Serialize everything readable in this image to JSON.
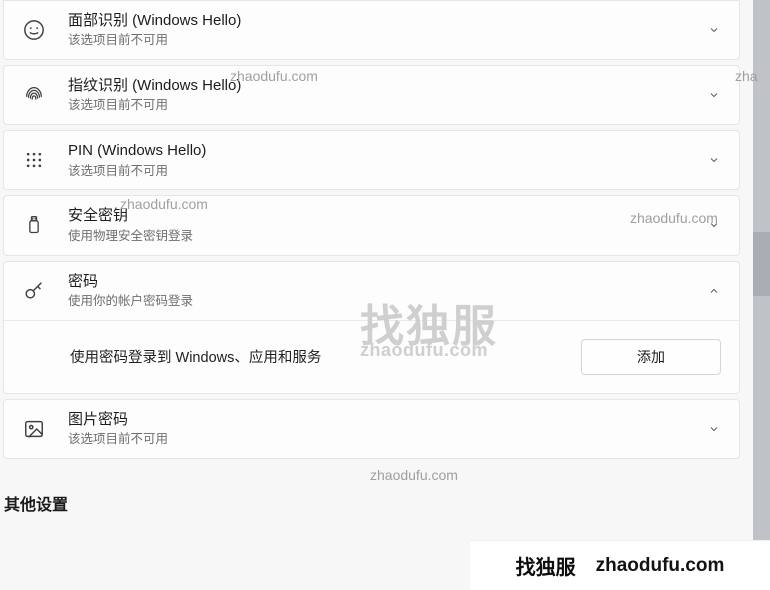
{
  "options": {
    "face": {
      "title": "面部识别 (Windows Hello)",
      "subtitle": "该选项目前不可用"
    },
    "fingerprint": {
      "title": "指纹识别 (Windows Hello)",
      "subtitle": "该选项目前不可用"
    },
    "pin": {
      "title": "PIN (Windows Hello)",
      "subtitle": "该选项目前不可用"
    },
    "securitykey": {
      "title": "安全密钥",
      "subtitle": "使用物理安全密钥登录"
    },
    "password": {
      "title": "密码",
      "subtitle": "使用你的帐户密码登录",
      "expanded_text": "使用密码登录到 Windows、应用和服务",
      "add_button": "添加"
    },
    "picturepwd": {
      "title": "图片密码",
      "subtitle": "该选项目前不可用"
    }
  },
  "section_heading": "其他设置",
  "watermarks": {
    "domain": "zhaodufu.com",
    "brand_cn": "找独服"
  },
  "banner": {
    "brand_cn": "找独服",
    "domain": "zhaodufu.com"
  }
}
